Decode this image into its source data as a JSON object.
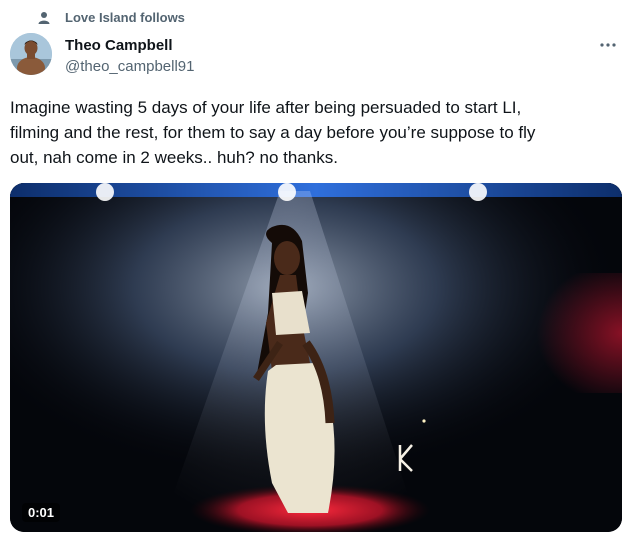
{
  "social_context": {
    "text": "Love Island follows",
    "icon": "person-icon"
  },
  "author": {
    "display_name": "Theo Campbell",
    "handle": "@theo_campbell91",
    "avatar_icon": "avatar"
  },
  "more_icon": "more-options-icon",
  "tweet": {
    "text": "Imagine wasting 5 days of your life after being persuaded to start LI,\nfilming and the rest, for them to say a day before you’re suppose to fly\nout, nah come in 2 weeks.. huh? no thanks."
  },
  "video": {
    "duration": "0:01",
    "overlay_letter": "K"
  },
  "colors": {
    "text_primary": "#0f1419",
    "text_secondary": "#536471",
    "stage_blue": "#1e4fa8",
    "stage_red": "#d11a2a"
  }
}
